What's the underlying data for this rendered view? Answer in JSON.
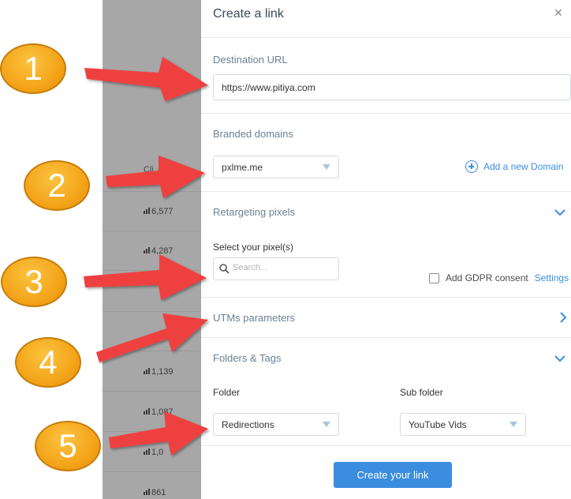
{
  "background": {
    "clicks_header": "Cli",
    "stats": [
      "6,577",
      "4,287",
      "1,139",
      "1,087",
      "1,0",
      "861"
    ],
    "list_color": "#a7a7a7"
  },
  "panel": {
    "title": "Create a link",
    "close_icon": "close-icon",
    "destination": {
      "label": "Destination URL",
      "value": "https://www.pitiya.com"
    },
    "branded": {
      "label": "Branded domains",
      "selected": "pxlme.me",
      "add_label": "Add a new Domain"
    },
    "retargeting": {
      "label": "Retargeting pixels",
      "select_label": "Select your pixel(s)",
      "search_placeholder": "Search...",
      "gdpr_label": "Add GDPR consent",
      "settings_label": "Settings"
    },
    "utm": {
      "label": "UTMs parameters"
    },
    "folders": {
      "label": "Folders & Tags",
      "folder_label": "Folder",
      "folder_value": "Redirections",
      "subfolder_label": "Sub folder",
      "subfolder_value": "YouTube Vids"
    },
    "submit_label": "Create your link",
    "accent_color": "#3b8de0"
  },
  "annotations": {
    "numbers": [
      "1",
      "2",
      "3",
      "4",
      "5"
    ],
    "badge_color": "#f3a217",
    "arrow_color": "#ef3f3f"
  }
}
